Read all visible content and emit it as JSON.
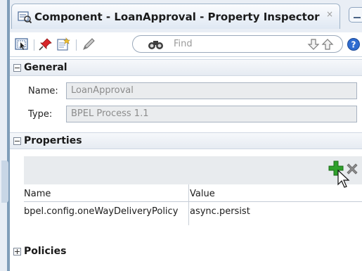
{
  "tab": {
    "title": "Component - LoanApproval - Property Inspector",
    "close_glyph": "×"
  },
  "toolbar": {
    "find_placeholder": "Find"
  },
  "general": {
    "title": "General",
    "name_label": "Name:",
    "name_value": "LoanApproval",
    "type_label": "Type:",
    "type_value": "BPEL Process 1.1"
  },
  "properties": {
    "title": "Properties",
    "columns": [
      "Name",
      "Value"
    ],
    "rows": [
      {
        "name": "bpel.config.oneWayDeliveryPolicy",
        "value": "async.persist"
      }
    ]
  },
  "policies": {
    "title": "Policies"
  },
  "colors": {
    "add": "#2fa12c",
    "remove": "#8a8a8a",
    "header_bg": "#e6ebf2"
  }
}
